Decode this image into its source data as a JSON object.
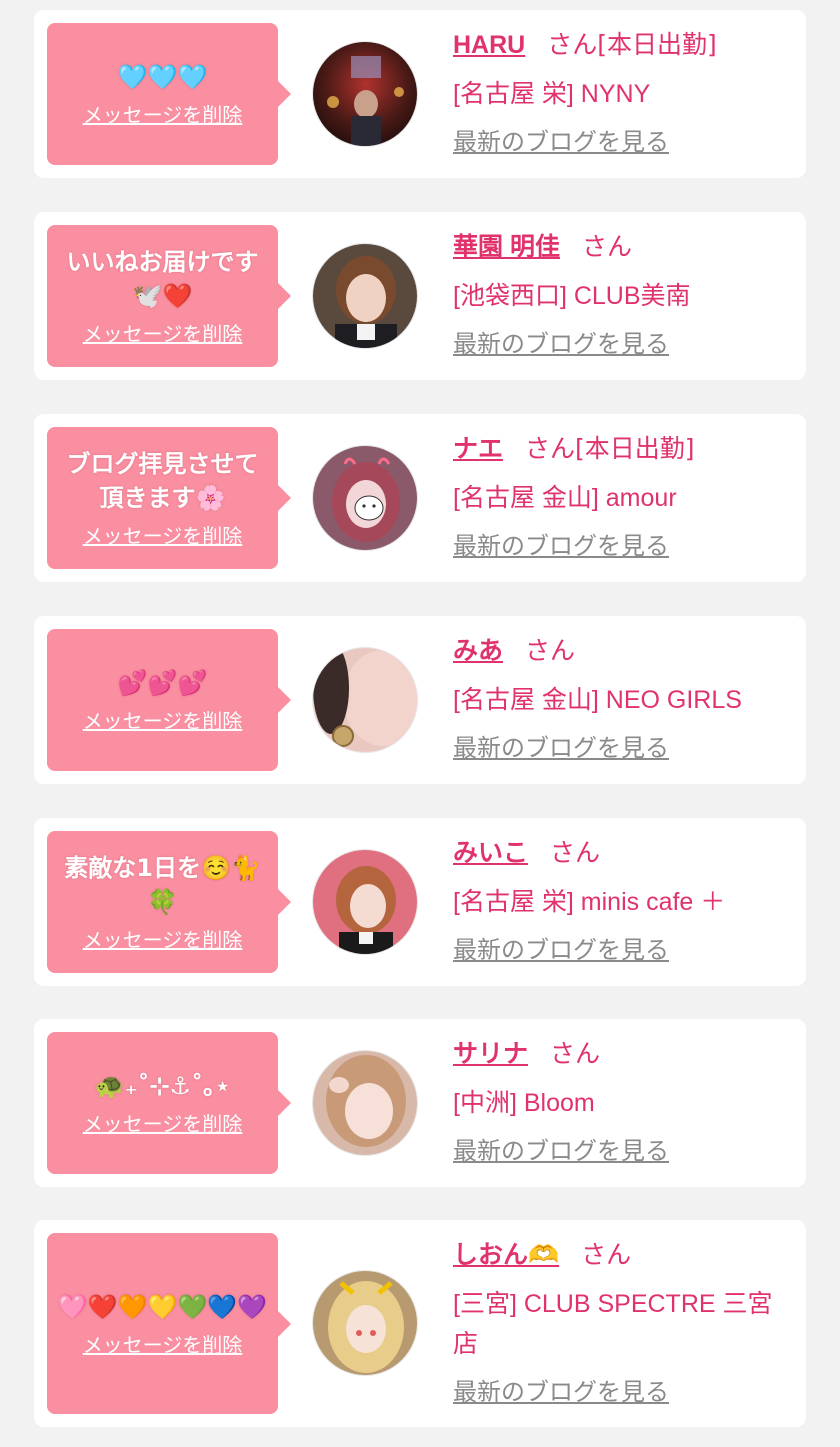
{
  "delete_label": "メッセージを削除",
  "blog_label": "最新のブログを見る",
  "honorific": "さん",
  "colors": {
    "page_bg": "#f2f2f2",
    "card_bg": "#ffffff",
    "bubble_bg": "#f98fa0",
    "name_color": "#e0336b",
    "blog_link_color": "#8a8a8a"
  },
  "cards": [
    {
      "message": "🩵🩵🩵",
      "name": "HARU",
      "status": "[本日出勤]",
      "shop": "[名古屋 栄] NYNY",
      "avatar_icon": "avatar-photo-icon"
    },
    {
      "message": "いいねお届けです🕊️❤️",
      "name": "華園 明佳",
      "status": "",
      "shop": "[池袋西口] CLUB美南",
      "avatar_icon": "avatar-photo-icon"
    },
    {
      "message": "ブログ拝見させて頂きます🌸",
      "name": "ナエ",
      "status": "[本日出勤]",
      "shop": "[名古屋 金山] amour",
      "avatar_icon": "avatar-photo-icon"
    },
    {
      "message": "💕💕💕",
      "name": "みあ",
      "status": "",
      "shop": "[名古屋 金山] NEO GIRLS",
      "avatar_icon": "avatar-photo-icon"
    },
    {
      "message": "素敵な1日を☺️🐈🍀",
      "name": "みいこ",
      "status": "",
      "shop": "[名古屋 栄] minis cafe ＋",
      "avatar_icon": "avatar-photo-icon"
    },
    {
      "message": "🐢₊˚⊹⚓︎˚｡⋆",
      "name": "サリナ",
      "status": "",
      "shop": "[中洲] Bloom",
      "avatar_icon": "avatar-photo-icon"
    },
    {
      "message": "🩷❤️🧡💛💚💙💜",
      "name": "しおん🫶",
      "status": "",
      "shop": "[三宮] CLUB SPECTRE 三宮店",
      "avatar_icon": "avatar-photo-icon"
    }
  ]
}
